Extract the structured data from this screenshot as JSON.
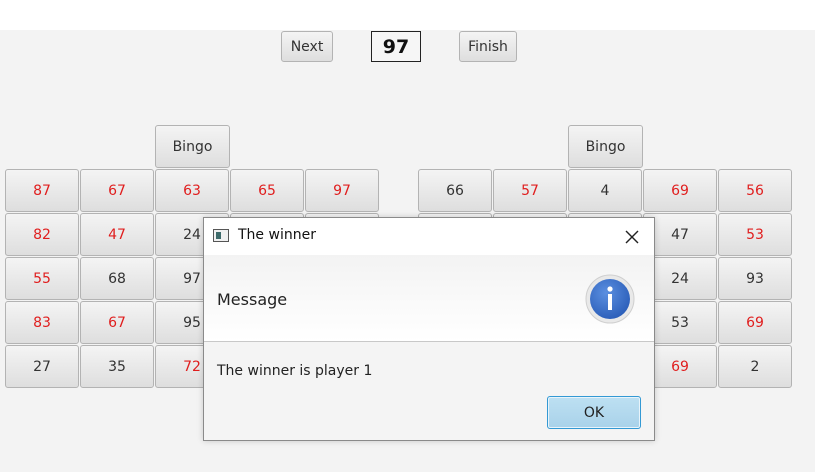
{
  "controls": {
    "next_label": "Next",
    "current_number": "97",
    "finish_label": "Finish"
  },
  "board_left": {
    "bingo_label": "Bingo",
    "rows": [
      [
        {
          "n": "87",
          "marked": true
        },
        {
          "n": "67",
          "marked": true
        },
        {
          "n": "63",
          "marked": true
        },
        {
          "n": "65",
          "marked": true
        },
        {
          "n": "97",
          "marked": true
        }
      ],
      [
        {
          "n": "82",
          "marked": true
        },
        {
          "n": "47",
          "marked": true
        },
        {
          "n": "24",
          "marked": false
        },
        {
          "n": "",
          "marked": false
        },
        {
          "n": "",
          "marked": false
        }
      ],
      [
        {
          "n": "55",
          "marked": true
        },
        {
          "n": "68",
          "marked": false
        },
        {
          "n": "97",
          "marked": false
        },
        {
          "n": "",
          "marked": false
        },
        {
          "n": "",
          "marked": false
        }
      ],
      [
        {
          "n": "83",
          "marked": true
        },
        {
          "n": "67",
          "marked": true
        },
        {
          "n": "95",
          "marked": false
        },
        {
          "n": "",
          "marked": false
        },
        {
          "n": "",
          "marked": false
        }
      ],
      [
        {
          "n": "27",
          "marked": false
        },
        {
          "n": "35",
          "marked": false
        },
        {
          "n": "72",
          "marked": true
        },
        {
          "n": "",
          "marked": false
        },
        {
          "n": "",
          "marked": false
        }
      ]
    ]
  },
  "board_right": {
    "bingo_label": "Bingo",
    "rows": [
      [
        {
          "n": "66",
          "marked": false
        },
        {
          "n": "57",
          "marked": true
        },
        {
          "n": "4",
          "marked": false
        },
        {
          "n": "69",
          "marked": true
        },
        {
          "n": "56",
          "marked": true
        }
      ],
      [
        {
          "n": "",
          "marked": false
        },
        {
          "n": "",
          "marked": false
        },
        {
          "n": "",
          "marked": false
        },
        {
          "n": "47",
          "marked": false
        },
        {
          "n": "53",
          "marked": true
        }
      ],
      [
        {
          "n": "",
          "marked": false
        },
        {
          "n": "",
          "marked": false
        },
        {
          "n": "",
          "marked": false
        },
        {
          "n": "24",
          "marked": false
        },
        {
          "n": "93",
          "marked": false
        }
      ],
      [
        {
          "n": "",
          "marked": false
        },
        {
          "n": "",
          "marked": false
        },
        {
          "n": "",
          "marked": false
        },
        {
          "n": "53",
          "marked": false
        },
        {
          "n": "69",
          "marked": true
        }
      ],
      [
        {
          "n": "",
          "marked": false
        },
        {
          "n": "",
          "marked": false
        },
        {
          "n": "",
          "marked": false
        },
        {
          "n": "69",
          "marked": true
        },
        {
          "n": "2",
          "marked": false
        }
      ]
    ]
  },
  "dialog": {
    "title": "The winner",
    "header": "Message",
    "content": "The winner is player 1",
    "ok_label": "OK",
    "title_icon": "app-window-icon",
    "header_icon": "info-icon",
    "close_icon": "close-icon"
  },
  "colors": {
    "marked": "#e01e1e",
    "unmarked": "#333333",
    "info_blue": "#3a6fc8",
    "ok_border": "#3399d4"
  }
}
